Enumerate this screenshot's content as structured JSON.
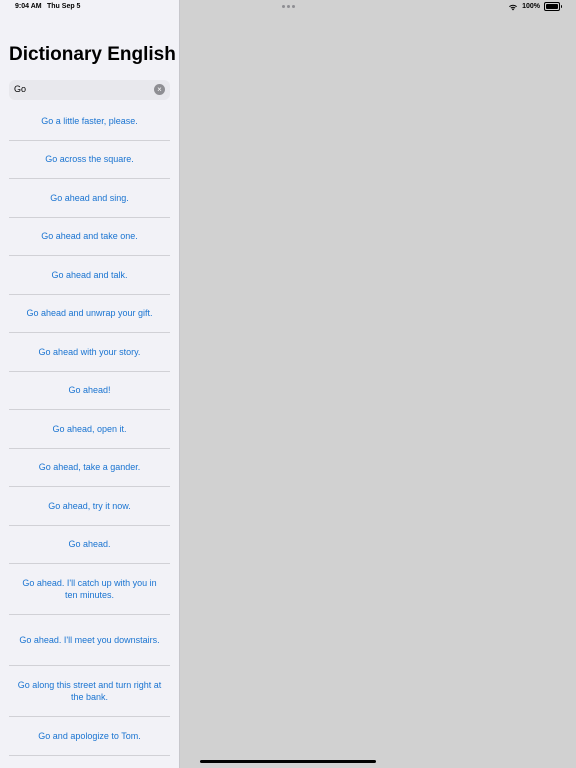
{
  "status_bar": {
    "time": "9:04 AM",
    "date": "Thu Sep 5",
    "battery_text": "100%",
    "battery_level": 100,
    "icons": {
      "wifi": "wifi-icon",
      "battery": "battery-icon",
      "multitasking": "more-dots-icon"
    }
  },
  "app": {
    "title": "Dictionary English"
  },
  "search": {
    "value": "Go",
    "clear_icon": "clear-icon"
  },
  "results": [
    {
      "text": "Go a little faster, please."
    },
    {
      "text": "Go across the square."
    },
    {
      "text": "Go ahead and sing."
    },
    {
      "text": "Go ahead and take one."
    },
    {
      "text": "Go ahead and talk."
    },
    {
      "text": "Go ahead and unwrap your gift."
    },
    {
      "text": "Go ahead with your story."
    },
    {
      "text": "Go ahead!"
    },
    {
      "text": "Go ahead, open it."
    },
    {
      "text": "Go ahead, take a gander."
    },
    {
      "text": "Go ahead, try it now."
    },
    {
      "text": "Go ahead."
    },
    {
      "text": "Go ahead. I'll catch up with you in ten minutes."
    },
    {
      "text": "Go ahead. I'll meet you downstairs."
    },
    {
      "text": "Go along this street and turn right at the bank."
    },
    {
      "text": "Go and apologize to Tom."
    }
  ],
  "colors": {
    "link": "#1a74d1",
    "sidebar_bg": "#f2f2f7",
    "detail_bg": "#d1d1d1"
  }
}
